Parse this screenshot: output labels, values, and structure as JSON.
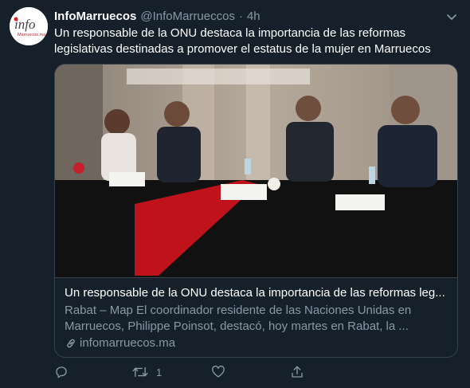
{
  "account": {
    "display_name": "InfoMarruecos",
    "handle": "@InfoMarrueccos",
    "separator": "·",
    "time": "4h",
    "avatar_text": "info",
    "avatar_subtext": "Marruecos.ma"
  },
  "tweet": {
    "text": "Un responsable de la ONU destaca la importancia de las reformas legislativas destinadas a promover el estatus de la mujer en Marruecos"
  },
  "card": {
    "title": "Un responsable de la ONU destaca la importancia de las reformas leg...",
    "description": "Rabat – Map El coordinador residente de las Naciones Unidas en Marruecos, Philippe Poinsot, destacó, hoy martes en Rabat, la ...",
    "domain": "infomarruecos.ma"
  },
  "actions": {
    "reply_count": "",
    "retweet_count": "1",
    "like_count": ""
  },
  "icons": {
    "caret": "chevron-down-icon",
    "reply": "reply-icon",
    "retweet": "retweet-icon",
    "like": "heart-icon",
    "share": "share-icon",
    "link": "link-icon"
  },
  "colors": {
    "background": "#15202b",
    "border": "#38444d",
    "secondary_text": "#8899a6",
    "text": "#ffffff"
  }
}
